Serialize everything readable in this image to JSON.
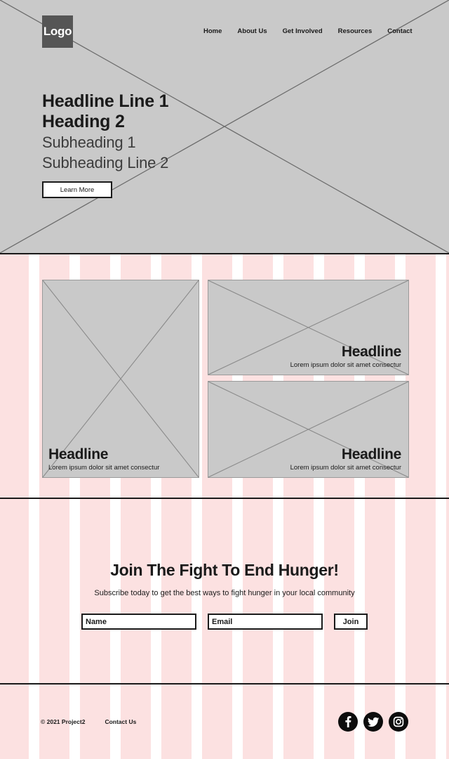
{
  "header": {
    "logo_label": "Logo",
    "nav_items": [
      {
        "label": "Home"
      },
      {
        "label": "About Us"
      },
      {
        "label": "Get Involved"
      },
      {
        "label": "Resources"
      },
      {
        "label": "Contact"
      }
    ]
  },
  "hero": {
    "headline_line_1": "Headline Line 1",
    "heading_2": "Heading 2",
    "subheading_1": "Subheading 1",
    "subheading_line_2": "Subheading Line 2",
    "cta_label": "Learn More",
    "background_color": "#c9c9c9"
  },
  "cards": [
    {
      "headline": "Headline",
      "description": "Lorem ipsum dolor sit amet consectur",
      "align": "left"
    },
    {
      "headline": "Headline",
      "description": "Lorem ipsum dolor sit amet consectur",
      "align": "right"
    },
    {
      "headline": "Headline",
      "description": "Lorem ipsum dolor sit amet consectur",
      "align": "right"
    }
  ],
  "newsletter": {
    "title": "Join The Fight To End Hunger!",
    "subtitle": "Subscribe today to get the best ways to fight hunger in your local community",
    "name_placeholder": "Name",
    "name_value": "",
    "email_placeholder": "Email",
    "email_value": "",
    "join_label": "Join"
  },
  "footer": {
    "copyright": "© 2021 Project2",
    "contact_label": "Contact Us",
    "social": [
      {
        "name": "facebook-icon"
      },
      {
        "name": "twitter-icon"
      },
      {
        "name": "instagram-icon"
      }
    ]
  },
  "theme": {
    "stripe_pink": "#fce1e1",
    "stripe_white": "#ffffff",
    "placeholder_gray": "#c9c9c9",
    "ink": "#1a1a1a",
    "logo_gray": "#555555"
  }
}
